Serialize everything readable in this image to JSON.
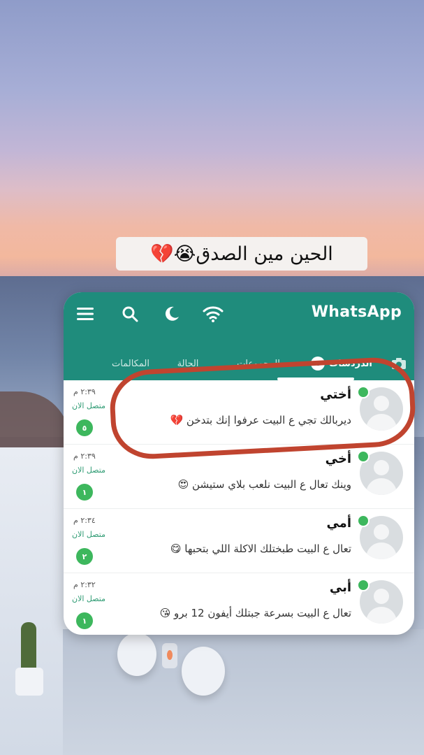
{
  "caption": {
    "text": "الحين مين الصدق😭💔"
  },
  "header": {
    "title": "WhatsApp",
    "icons": [
      "wifi-icon",
      "moon-icon",
      "search-icon",
      "menu-icon"
    ],
    "tabs": [
      {
        "label": "الدردشات",
        "badge": "٤"
      },
      {
        "label": "المجموعات"
      },
      {
        "label": "الحالة"
      },
      {
        "label": "المكالمات"
      }
    ]
  },
  "chats": [
    {
      "name": "أختي",
      "message": "ديربالك تجي ع البيت عرفوا إنك بتدخن 💔",
      "time": "٢:٣٩ م",
      "status": "متصل الان",
      "unread": "٥"
    },
    {
      "name": "أخي",
      "message": "وينك تعال ع البيت نلعب بلاي ستيشن 😍",
      "time": "٢:٣٩ م",
      "status": "متصل الان",
      "unread": "١"
    },
    {
      "name": "أمي",
      "message": "تعال ع البيت طبختلك الاكلة اللي بتحبها 😋",
      "time": "٢:٣٤ م",
      "status": "متصل الان",
      "unread": "٢"
    },
    {
      "name": "أبي",
      "message": "تعال ع البيت بسرعة جبتلك أيفون 12 برو 😘",
      "time": "٢:٣٢ م",
      "status": "متصل الان",
      "unread": "١"
    }
  ],
  "colors": {
    "brand": "#1f8c7c",
    "online": "#3db75d",
    "annotation": "#c0442f"
  }
}
